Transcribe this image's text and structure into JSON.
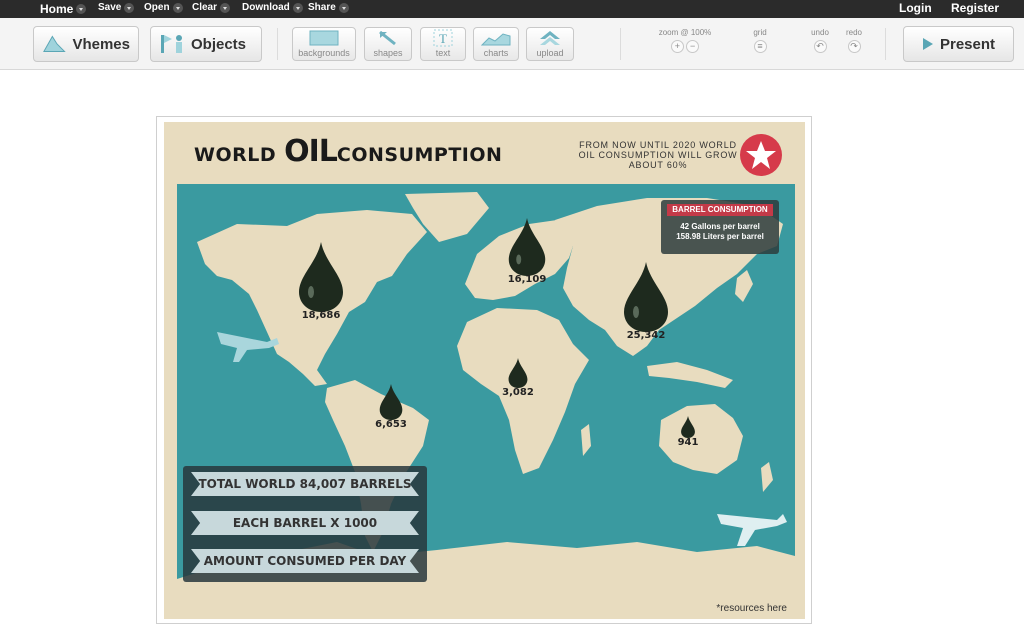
{
  "topbar": {
    "home": "Home",
    "save": "Save",
    "open": "Open",
    "clear": "Clear",
    "download": "Download",
    "share": "Share",
    "login": "Login",
    "register": "Register"
  },
  "toolbar": {
    "vhemes": "Vhemes",
    "objects": "Objects",
    "backgrounds": "backgrounds",
    "shapes": "shapes",
    "text": "text",
    "charts": "charts",
    "upload": "upload",
    "zoom_label": "zoom @ 100%",
    "grid_label": "grid",
    "undo_label": "undo",
    "redo_label": "redo",
    "present": "Present"
  },
  "poster": {
    "title_world": "WORLD",
    "title_oil": "OIL",
    "title_consumption": "CONSUMPTION",
    "note": "FROM NOW UNTIL 2020 WORLD OIL CONSUMPTION WILL GROW ABOUT 60%",
    "infobox": {
      "header": "BARREL CONSUMPTION",
      "line1": "42 Gallons per barrel",
      "line2": "158.98 Liters per barrel"
    },
    "drops": [
      {
        "label": "18,686"
      },
      {
        "label": "16,109"
      },
      {
        "label": "25,342"
      },
      {
        "label": "6,653"
      },
      {
        "label": "3,082"
      },
      {
        "label": "941"
      }
    ],
    "ribbons": {
      "r1": "TOTAL WORLD 84,007 BARRELS",
      "r2": "EACH BARREL X 1000",
      "r3": "AMOUNT CONSUMED PER DAY"
    },
    "resources": "*resources here"
  },
  "colors": {
    "ocean": "#3a9aa0",
    "land": "#e8dcbf",
    "accent_red": "#d63a4a",
    "drop": "#1e2a1e"
  }
}
